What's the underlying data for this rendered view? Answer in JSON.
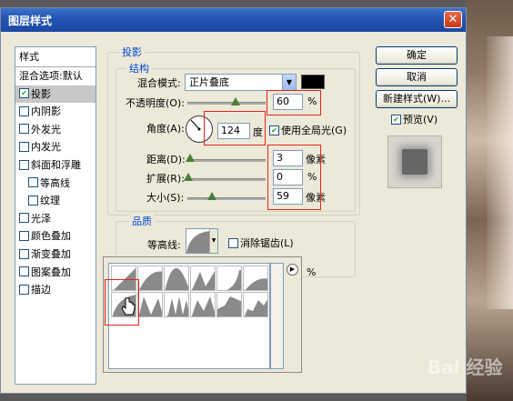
{
  "window": {
    "title": "图层样式",
    "close": "✕"
  },
  "style_list": {
    "header": "样式",
    "items": [
      {
        "label": "混合选项:默认",
        "checkbox": false,
        "checked": false,
        "selected": false
      },
      {
        "label": "投影",
        "checkbox": true,
        "checked": true,
        "selected": true
      },
      {
        "label": "内阴影",
        "checkbox": true,
        "checked": false,
        "selected": false
      },
      {
        "label": "外发光",
        "checkbox": true,
        "checked": false,
        "selected": false
      },
      {
        "label": "内发光",
        "checkbox": true,
        "checked": false,
        "selected": false
      },
      {
        "label": "斜面和浮雕",
        "checkbox": true,
        "checked": false,
        "selected": false
      },
      {
        "label": "等高线",
        "checkbox": true,
        "checked": false,
        "selected": false
      },
      {
        "label": "纹理",
        "checkbox": true,
        "checked": false,
        "selected": false
      },
      {
        "label": "光泽",
        "checkbox": true,
        "checked": false,
        "selected": false
      },
      {
        "label": "颜色叠加",
        "checkbox": true,
        "checked": false,
        "selected": false
      },
      {
        "label": "渐变叠加",
        "checkbox": true,
        "checked": false,
        "selected": false
      },
      {
        "label": "图案叠加",
        "checkbox": true,
        "checked": false,
        "selected": false
      },
      {
        "label": "描边",
        "checkbox": true,
        "checked": false,
        "selected": false
      }
    ]
  },
  "shadow": {
    "section_title": "投影",
    "structure_title": "结构",
    "blend_mode_label": "混合模式:",
    "blend_mode_value": "正片叠底",
    "shadow_color": "#000000",
    "opacity_label": "不透明度(O):",
    "opacity_value": "60",
    "opacity_unit": "%",
    "angle_label": "角度(A):",
    "angle_value": "124",
    "angle_unit": "度",
    "global_light_label": "使用全局光(G)",
    "global_light_checked": true,
    "distance_label": "距离(D):",
    "distance_value": "3",
    "distance_unit": "像素",
    "spread_label": "扩展(R):",
    "spread_value": "0",
    "spread_unit": "%",
    "size_label": "大小(S):",
    "size_value": "59",
    "size_unit": "像素",
    "quality_title": "品质",
    "contour_label": "等高线:",
    "anti_alias_label": "消除锯齿(L)",
    "noise_unit": "%"
  },
  "buttons": {
    "ok": "确定",
    "cancel": "取消",
    "new_style": "新建样式(W)...",
    "preview_label": "预览(V)",
    "preview_checked": true
  },
  "contour_picker": {
    "menu_icon": "arrow-right-icon",
    "swatch_count": 12,
    "selected_index": 6
  },
  "watermark": "Bai 经验"
}
